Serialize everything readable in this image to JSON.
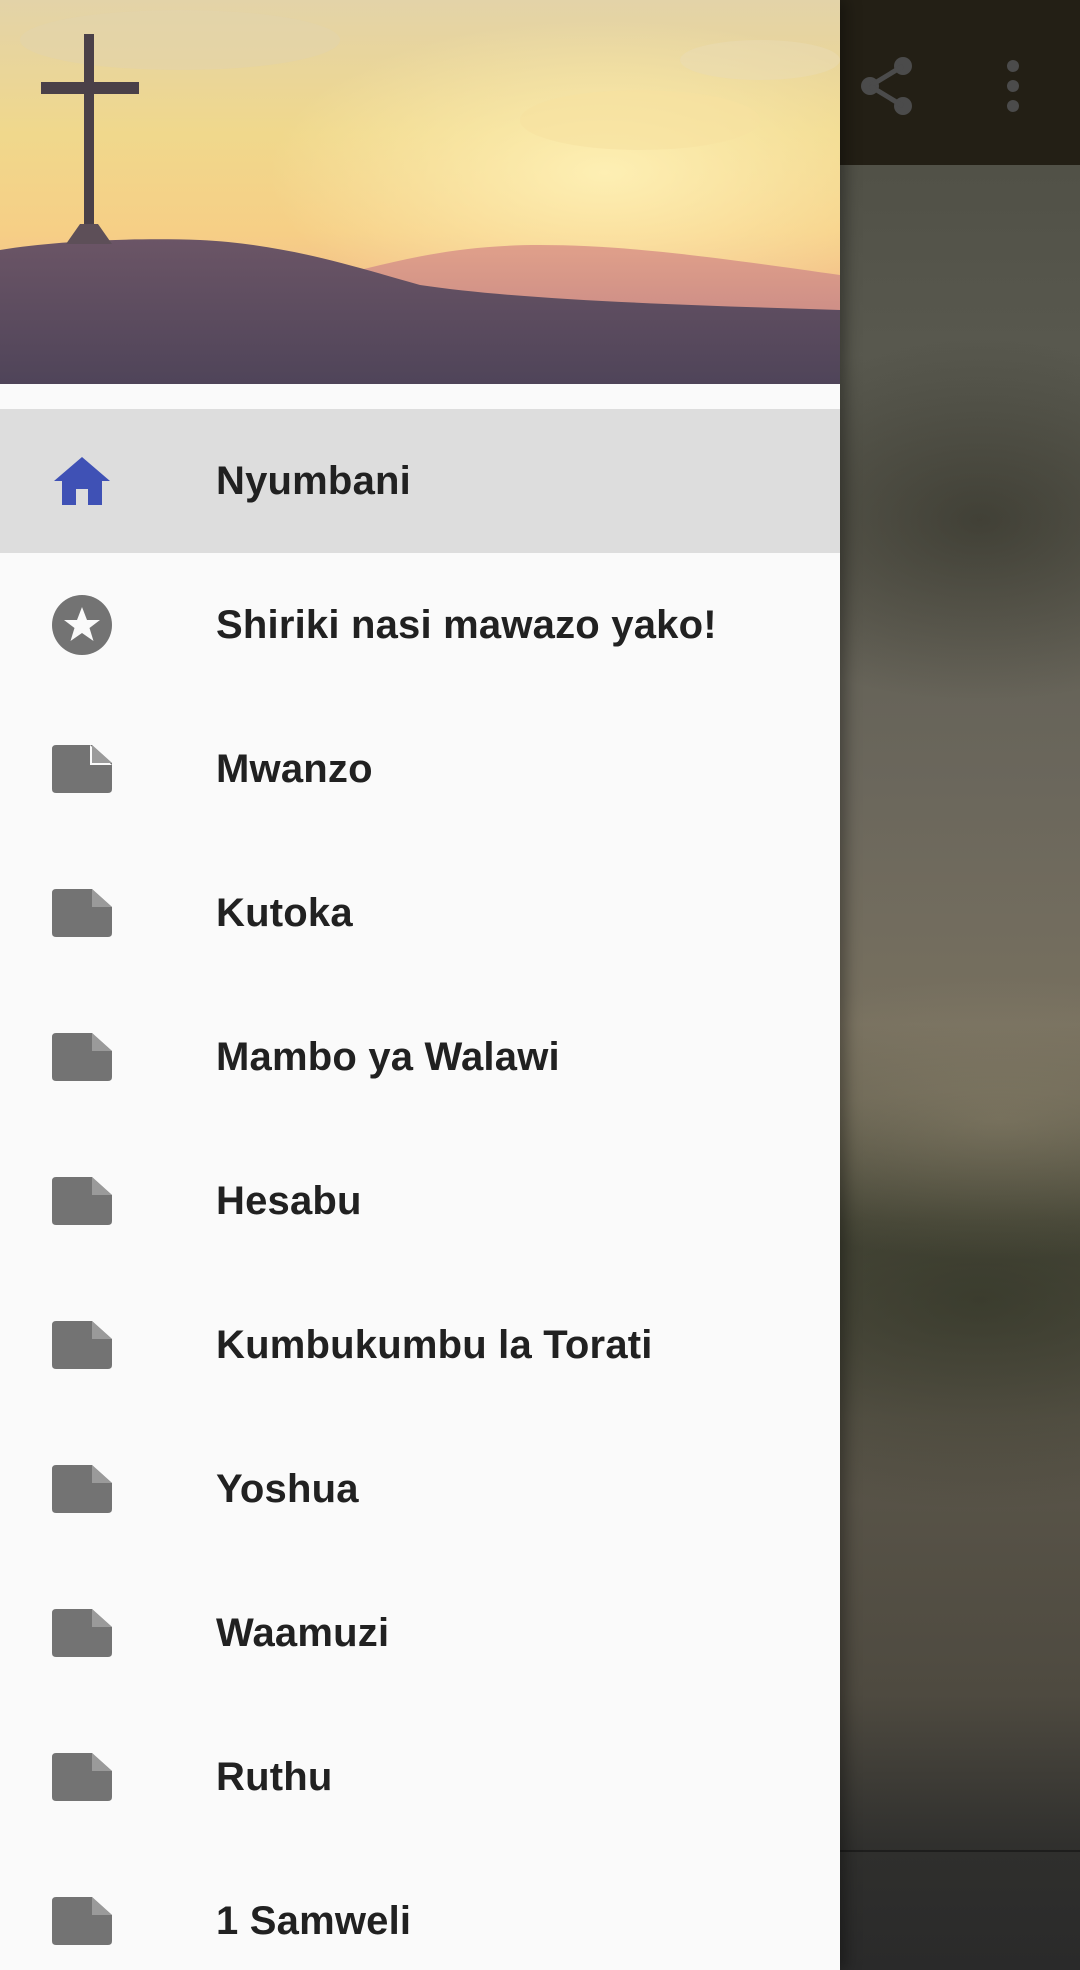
{
  "app_bar": {
    "share_icon": "share-icon",
    "more_icon": "more-vert-icon"
  },
  "drawer": {
    "header_image": "cross-on-hill-sunset-image",
    "items": [
      {
        "label": "Nyumbani",
        "icon": "home-icon",
        "active": true
      },
      {
        "label": "Shiriki nasi mawazo yako!",
        "icon": "star-circle-icon",
        "active": false
      },
      {
        "label": "Mwanzo",
        "icon": "file-icon",
        "active": false
      },
      {
        "label": "Kutoka",
        "icon": "file-icon",
        "active": false
      },
      {
        "label": "Mambo ya Walawi",
        "icon": "file-icon",
        "active": false
      },
      {
        "label": "Hesabu",
        "icon": "file-icon",
        "active": false
      },
      {
        "label": "Kumbukumbu la Torati",
        "icon": "file-icon",
        "active": false
      },
      {
        "label": "Yoshua",
        "icon": "file-icon",
        "active": false
      },
      {
        "label": "Waamuzi",
        "icon": "file-icon",
        "active": false
      },
      {
        "label": "Ruthu",
        "icon": "file-icon",
        "active": false
      },
      {
        "label": "1 Samweli",
        "icon": "file-icon",
        "active": false
      }
    ]
  },
  "colors": {
    "active_icon": "#3f51b5",
    "inactive_icon": "#737373",
    "active_row": "#dddddd",
    "drawer_background": "#fafafa",
    "toolbar": "#231f15"
  }
}
